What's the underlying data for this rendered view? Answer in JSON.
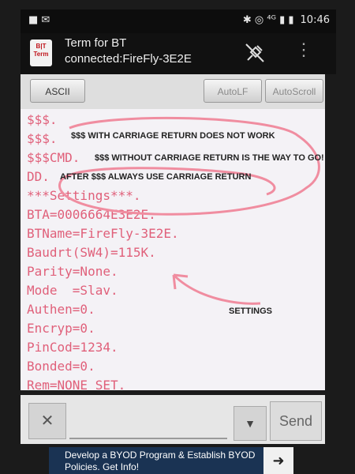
{
  "statusbar": {
    "left_icons": "■ ✉",
    "right_icons": "✱ ◎ ⁴ᴳ ▮ ▮",
    "time": "10:46"
  },
  "app": {
    "title": "Term for BT",
    "subtitle": "connected:FireFly-3E2E",
    "icon_text": "B|T Term"
  },
  "toolbar": {
    "ascii": "ASCII",
    "autolf": "AutoLF",
    "autoscroll": "AutoScroll"
  },
  "terminal_lines": [
    "$$$.",
    "$$$.",
    "$$$CMD.",
    "DD.",
    "***Settings***.",
    "BTA=0006664E3E2E.",
    "BTName=FireFly-3E2E.",
    "Baudrt(SW4)=115K.",
    "Parity=None.",
    "Mode  =Slav.",
    "Authen=0.",
    "Encryp=0.",
    "PinCod=1234.",
    "Bonded=0.",
    "Rem=NONE SET."
  ],
  "annotations": {
    "note1": "$$$ WITH CARRIAGE RETURN DOES NOT WORK",
    "note2": "$$$ WITHOUT CARRIAGE RETURN IS THE WAY TO GO!",
    "note3": "AFTER $$$ ALWAYS USE CARRIAGE RETURN",
    "settings": "SETTINGS"
  },
  "bottom": {
    "clear": "✕",
    "input_value": "",
    "dropdown": "▼",
    "send": "Send"
  },
  "ad": {
    "text": "Develop a BYOD Program & Establish BYOD Policies. Get Info!"
  },
  "colors": {
    "terminal_text": "#e0607a",
    "annotation_stroke": "#f08da0"
  }
}
